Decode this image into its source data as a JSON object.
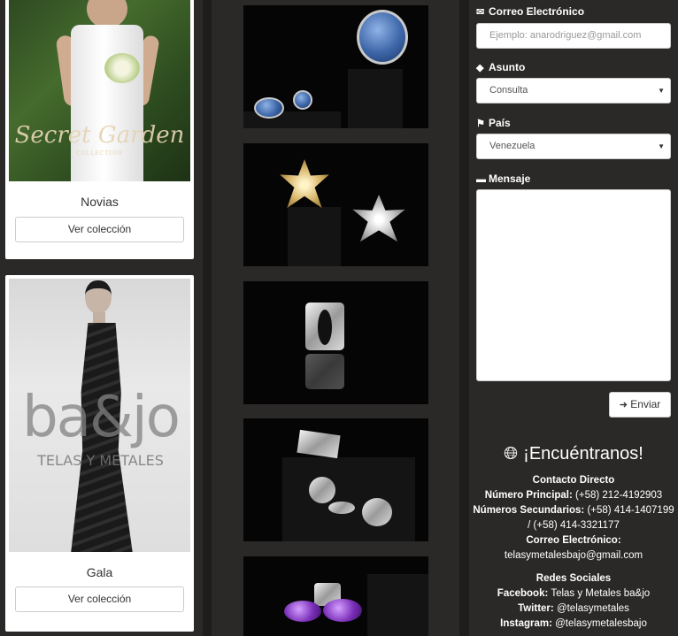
{
  "collections": [
    {
      "title": "Novias",
      "button_label": "Ver colección",
      "photo_text": "Secret Garden",
      "photo_subtext": "COLLECTION"
    },
    {
      "title": "Gala",
      "button_label": "Ver colección",
      "photo_text": "ba&jo",
      "photo_subtext": "TELAS Y METALES"
    }
  ],
  "contact_form": {
    "email_label": "Correo Electrónico",
    "email_placeholder": "Ejemplo: anarodriguez@gmail.com",
    "subject_label": "Asunto",
    "subject_value": "Consulta",
    "country_label": "País",
    "country_value": "Venezuela",
    "message_label": "Mensaje",
    "send_label": "Enviar"
  },
  "find_us": {
    "title": "¡Encuéntranos!",
    "direct_contact_heading": "Contacto Directo",
    "main_number_label": "Número Principal:",
    "main_number": "(+58) 212-4192903",
    "secondary_numbers_label": "Números Secundarios:",
    "secondary_numbers": "(+58) 414-1407199 / (+58) 414-3321177",
    "email_label": "Correo Electrónico:",
    "email": "telasymetalesbajo@gmail.com",
    "social_heading": "Redes Sociales",
    "facebook_label": "Facebook:",
    "facebook": "Telas y Metales ba&jo",
    "twitter_label": "Twitter:",
    "twitter": "@telasymetales",
    "instagram_label": "Instagram:",
    "instagram": "@telasymetalesbajo"
  },
  "icons": {
    "email": "envelope-icon",
    "subject": "tag-icon",
    "country": "flag-icon",
    "message": "comment-icon",
    "send": "arrow-circle-icon",
    "find": "globe-icon"
  },
  "colors": {
    "background": "#2b2928",
    "text_light": "#ffffff",
    "card_bg": "#ffffff"
  }
}
